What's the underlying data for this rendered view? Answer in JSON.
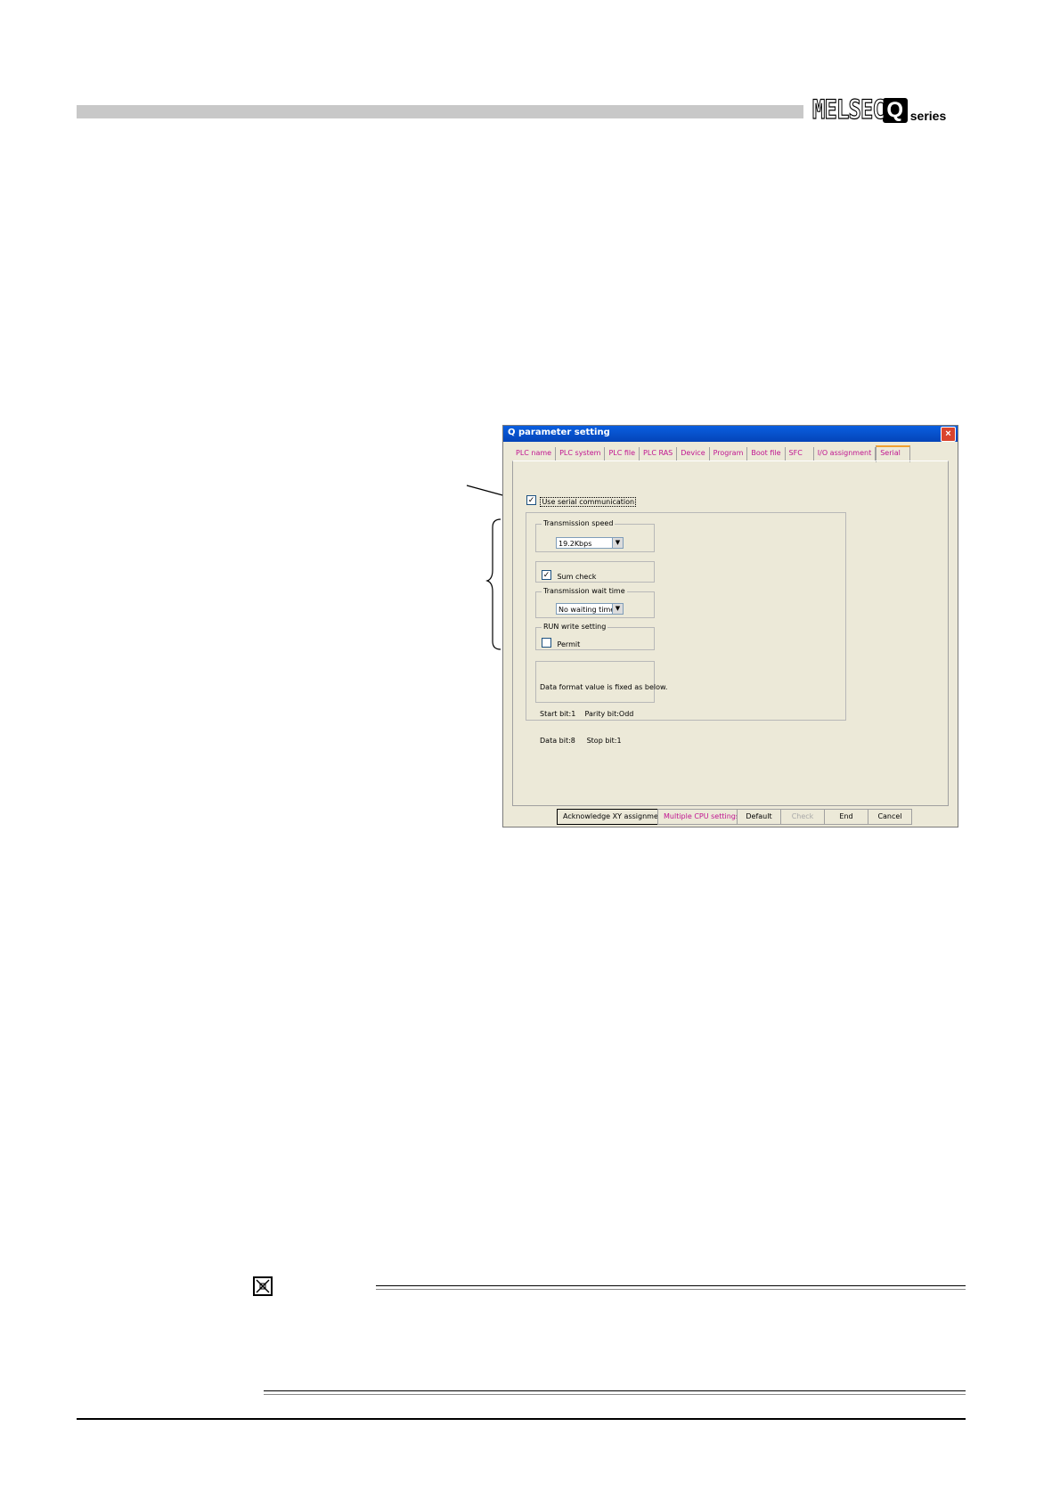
{
  "header": {
    "logo_text": "MELSEC",
    "logo_q": "Q",
    "logo_series": "series"
  },
  "dialog": {
    "title": "Q parameter setting",
    "close": "×",
    "tabs": [
      "PLC name",
      "PLC system",
      "PLC file",
      "PLC RAS",
      "Device",
      "Program",
      "Boot file",
      "SFC",
      "I/O assignment",
      "Serial"
    ],
    "active_tab": "Serial",
    "use_serial": {
      "label": "Use serial communication",
      "checked": true
    },
    "transmission_speed": {
      "title": "Transmission speed",
      "value": "19.2Kbps"
    },
    "sum_check": {
      "label": "Sum check",
      "checked": true
    },
    "wait_time": {
      "title": "Transmission wait time",
      "value": "No waiting time"
    },
    "run_write": {
      "title": "RUN write setting",
      "label": "Permit",
      "checked": false
    },
    "data_format": {
      "line1": "Data format value is fixed as below.",
      "line2": "Start bit:1    Parity bit:Odd",
      "line3": "Data bit:8     Stop bit:1"
    },
    "buttons": {
      "ack_xy": "Acknowledge XY assignment",
      "multi_cpu": "Multiple CPU settings",
      "default": "Default",
      "check": "Check",
      "end": "End",
      "cancel": "Cancel"
    },
    "colors": {
      "tab_text": "#c01490",
      "titlebar": "#0a5fe0"
    }
  },
  "icons": {
    "point": "point-icon",
    "arrow": "arrow-icon",
    "brace": "brace-icon"
  }
}
